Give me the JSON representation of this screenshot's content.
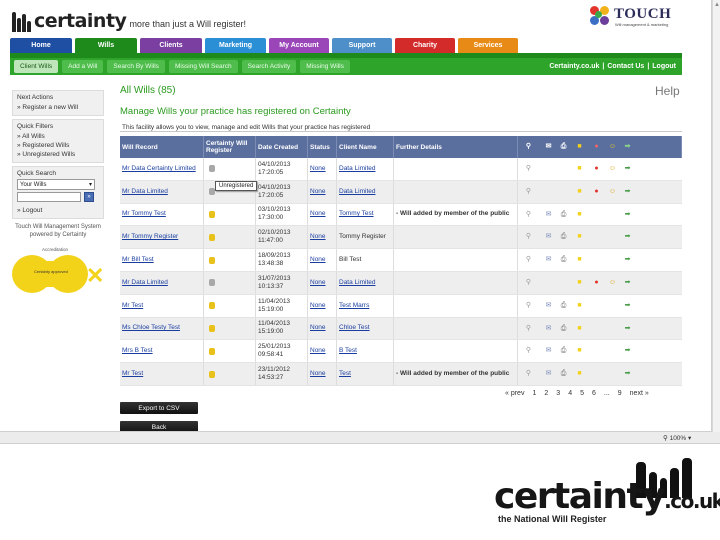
{
  "header": {
    "logo_text": "certainty",
    "logo_tagline": "more than just a Will register!",
    "partner_logo": "TOUCH",
    "partner_sub": "Will management & marketing"
  },
  "main_nav": [
    {
      "label": "Home",
      "color": "#1f4fa3"
    },
    {
      "label": "Wills",
      "color": "#1e8a1c"
    },
    {
      "label": "Clients",
      "color": "#7a3fa0"
    },
    {
      "label": "Marketing",
      "color": "#2b8fd6"
    },
    {
      "label": "My Account",
      "color": "#9b46b8"
    },
    {
      "label": "Support",
      "color": "#4f8fc9"
    },
    {
      "label": "Charity",
      "color": "#d32a2a"
    },
    {
      "label": "Services",
      "color": "#e88a16"
    }
  ],
  "sub_nav": {
    "items": [
      "Client Wills",
      "Add a Will",
      "Search By Wills",
      "Missing Will Search",
      "Search Activity",
      "Missing Wills"
    ],
    "active": "Client Wills",
    "right_links": [
      "Certainty.co.uk",
      "Contact Us",
      "Logout"
    ]
  },
  "sidebar": {
    "next_actions_title": "Next Actions",
    "next_actions": [
      "Register a new Will"
    ],
    "quick_filters_title": "Quick Filters",
    "quick_filters": [
      "All Wills",
      "Registered Wills",
      "Unregistered Wills"
    ],
    "quick_search_title": "Quick Search",
    "search_scope": "Your Wills",
    "go_label": "»",
    "logout": "Logout",
    "credit": "Touch Will Management System powered by Certainty",
    "badge_label": "Accreditation",
    "badge_text": "Certainty approved",
    "colors": {
      "badge": "#f3d21a"
    }
  },
  "content": {
    "title": "All Wills (85)",
    "help": "Help",
    "subtitle": "Manage Wills your practice has registered on Certainty",
    "description": "This facility allows you to view, manage and edit Wills that your practice has registered",
    "tooltip": "Unregistered"
  },
  "table": {
    "headers": [
      "Will Record",
      "Certainty Will Register",
      "Date Created",
      "Status",
      "Client Name",
      "Further Details"
    ],
    "rows": [
      {
        "record": "Mr Data Certainty Limited",
        "registered": false,
        "date": "04/10/2013",
        "time": "17:20:05",
        "status": "None",
        "client": "Data Limited",
        "details": "",
        "actions": 6
      },
      {
        "record": "Mr Data Limited",
        "registered": false,
        "date": "04/10/2013",
        "time": "17:20:05",
        "status": "None",
        "client": "Data Limited",
        "details": "",
        "actions": 6
      },
      {
        "record": "Mr Tommy Test",
        "registered": true,
        "date": "03/10/2013",
        "time": "17:30:00",
        "status": "None",
        "client": "Tommy Test",
        "details": "Will added by member of the public",
        "actions": 4
      },
      {
        "record": "Mr Tommy Register",
        "registered": true,
        "date": "02/10/2013",
        "time": "11:47:00",
        "status": "None",
        "client": "Tommy Register",
        "details": "",
        "actions": 4
      },
      {
        "record": "Mr Bill Test",
        "registered": true,
        "date": "18/09/2013",
        "time": "13:48:38",
        "status": "None",
        "client": "Bill Test",
        "details": "",
        "actions": 4
      },
      {
        "record": "Mr Data Limited",
        "registered": false,
        "date": "31/07/2013",
        "time": "10:13:37",
        "status": "None",
        "client": "Data Limited",
        "details": "",
        "actions": 6
      },
      {
        "record": "Mr Test",
        "registered": true,
        "date": "11/04/2013",
        "time": "15:19:00",
        "status": "None",
        "client": "Test Marrs",
        "details": "",
        "actions": 4
      },
      {
        "record": "Ms Chloe Testy Test",
        "registered": true,
        "date": "11/04/2013",
        "time": "15:19:00",
        "status": "None",
        "client": "Chloe Test",
        "details": "",
        "actions": 4
      },
      {
        "record": "Mrs B Test",
        "registered": true,
        "date": "25/01/2013",
        "time": "09:58:41",
        "status": "None",
        "client": "B Test",
        "details": "",
        "actions": 4
      },
      {
        "record": "Mr Test",
        "registered": true,
        "date": "23/11/2012",
        "time": "14:53:27",
        "status": "None",
        "client": "Test",
        "details": "Will added by member of the public",
        "actions": 4
      }
    ]
  },
  "pager": {
    "prev": "« prev",
    "pages": [
      "1",
      "2",
      "3",
      "4",
      "5",
      "6",
      "...",
      "9"
    ],
    "next": "next »"
  },
  "buttons": {
    "export": "Export to CSV",
    "back": "Back"
  },
  "statusbar": {
    "zoom": "100%"
  },
  "footer_logo": {
    "word": "certainty",
    "domain": ".co.uk",
    "tagline": "the National Will Register"
  }
}
